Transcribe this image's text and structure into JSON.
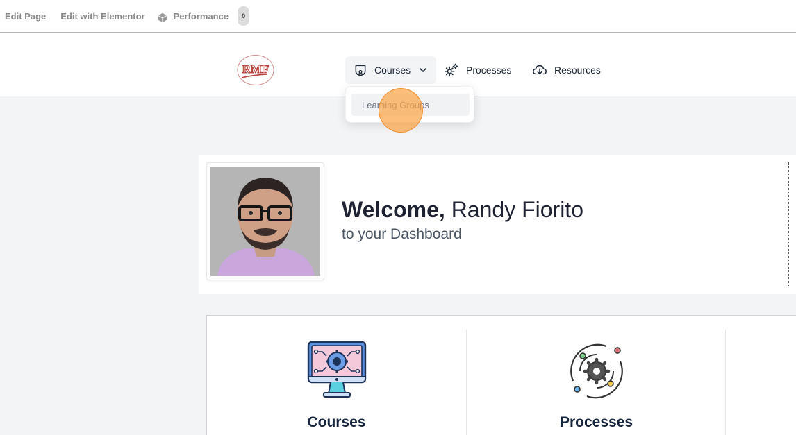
{
  "adminbar": {
    "edit_page": "Edit Page",
    "edit_elementor": "Edit with Elementor",
    "performance": "Performance",
    "performance_count": "0"
  },
  "header": {
    "logo_text": "RMF",
    "nav": {
      "courses": "Courses",
      "processes": "Processes",
      "resources": "Resources"
    },
    "dropdown": {
      "items": [
        "Learning Groups"
      ]
    }
  },
  "welcome": {
    "greeting": "Welcome,",
    "name": "Randy Fiorito",
    "subtitle": "to your Dashboard"
  },
  "tiles": [
    {
      "label": "Courses",
      "icon": "computer-gear-icon"
    },
    {
      "label": "Processes",
      "icon": "orbit-gear-icon"
    }
  ],
  "colors": {
    "accent_orange": "#fca548",
    "heading": "#17253f",
    "logo_red": "#c0392b"
  }
}
